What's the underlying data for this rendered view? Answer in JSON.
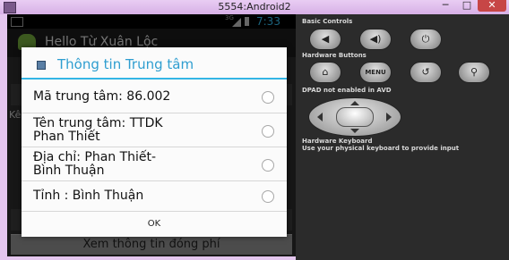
{
  "window": {
    "title": "5554:Android2",
    "min_glyph": "─",
    "max_glyph": "□",
    "close_glyph": "✕"
  },
  "status": {
    "network": "3G",
    "time": "7:33"
  },
  "app": {
    "title": "Hello Từ Xuân Lộc"
  },
  "background": {
    "label_partial": "Kê",
    "bottom_button": "Xem thông tin đóng phí"
  },
  "dialog": {
    "title": "Thông tin Trung tâm",
    "items": [
      {
        "label": "Mã trung tâm:  86.002"
      },
      {
        "label": "Tên trung tâm:  TTDK",
        "label2": "Phan Thiết"
      },
      {
        "label": "Địa chỉ:  Phan Thiết-",
        "label2": "Bình Thuận"
      },
      {
        "label": "Tỉnh   :  Bình Thuận"
      }
    ],
    "ok_label": "OK"
  },
  "controls": {
    "basic_title": "Basic Controls",
    "hardware_title": "Hardware Buttons",
    "menu_label": "MENU",
    "dpad_note": "DPAD not enabled in AVD",
    "keyboard_title": "Hardware Keyboard",
    "keyboard_hint": "Use your physical keyboard to provide input",
    "icons": {
      "volume_down": "◀",
      "volume_up": "◀)",
      "power": "⏻",
      "home": "⌂",
      "back": "↺",
      "search": "⚲"
    }
  }
}
